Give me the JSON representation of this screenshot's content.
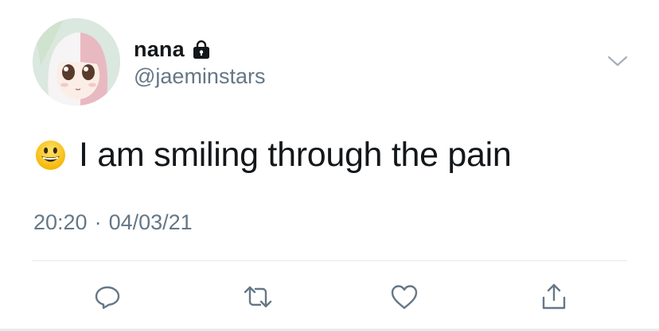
{
  "user": {
    "display_name": "nana",
    "handle": "@jaeminstars",
    "avatar_icon": "anime-character-avatar",
    "protected_icon": "lock-icon"
  },
  "tweet": {
    "emoji": "smiling-face-emoji",
    "text": "I am smiling through the pain",
    "time": "20:20",
    "separator": "·",
    "date": "04/03/21"
  },
  "actions": {
    "reply_icon": "reply-icon",
    "retweet_icon": "retweet-icon",
    "like_icon": "heart-icon",
    "share_icon": "share-icon"
  },
  "colors": {
    "text_primary": "#14171a",
    "text_secondary": "#657786",
    "icon": "#657786",
    "divider": "#e1e8ed"
  }
}
